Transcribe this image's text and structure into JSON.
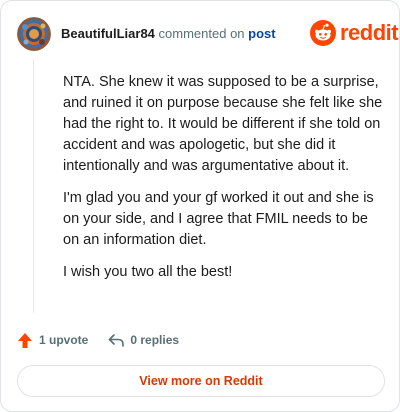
{
  "header": {
    "username": "BeautifulLiar84",
    "verb": "commented on",
    "post_link": "post"
  },
  "brand": {
    "wordmark": "reddit",
    "color": "#ff4500"
  },
  "comment": {
    "paragraphs": [
      "NTA. She knew it was supposed to be a surprise, and ruined it on purpose because she felt like she had the right to. It would be different if she told on accident and was apologetic, but she did it intentionally and was argumentative about it.",
      "I'm glad you and your gf worked it out and she is on your side, and I agree that FMIL needs to be on an information diet.",
      "I wish you two all the best!"
    ]
  },
  "actions": {
    "upvote_label": "1 upvote",
    "upvote_icon": "upvote-arrow-icon",
    "reply_label": "0 replies",
    "reply_icon": "reply-arrow-icon"
  },
  "footer": {
    "view_more_label": "View more on Reddit"
  },
  "colors": {
    "username": "#1c1c1c",
    "secondary": "#576f76",
    "link": "#0a449b",
    "upvote": "#ff4500",
    "view_more": "#d93900"
  }
}
